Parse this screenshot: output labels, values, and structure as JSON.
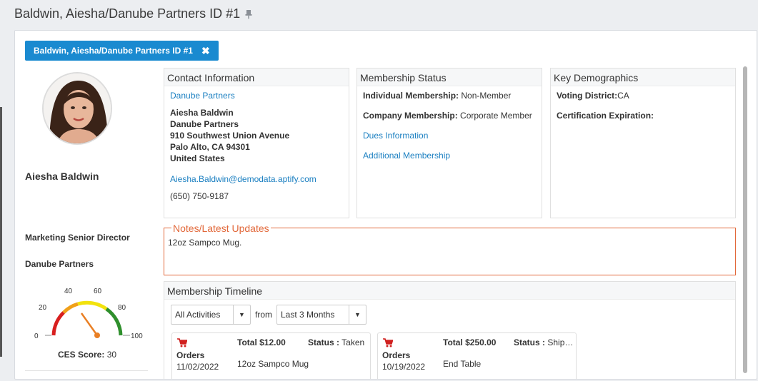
{
  "window": {
    "title": "Baldwin, Aiesha/Danube Partners ID #1"
  },
  "tab": {
    "label": "Baldwin, Aiesha/Danube Partners ID #1"
  },
  "profile": {
    "name": "Aiesha Baldwin",
    "job_title": "Marketing Senior Director",
    "company": "Danube Partners"
  },
  "ces": {
    "label": "CES Score:",
    "value": 30,
    "scale_labels": [
      "0",
      "20",
      "40",
      "60",
      "80",
      "100"
    ]
  },
  "contact": {
    "title": "Contact Information",
    "company_link": "Danube Partners",
    "name": "Aiesha Baldwin",
    "company": "Danube Partners",
    "street": "910 Southwest Union Avenue",
    "city": "Palo Alto, CA 94301",
    "country": "United States",
    "email": "Aiesha.Baldwin@demodata.aptify.com",
    "phone": "(650) 750-9187"
  },
  "membership": {
    "title": "Membership Status",
    "individual_label": "Individual Membership:",
    "individual_value": "Non-Member",
    "company_label": "Company Membership:",
    "company_value": "Corporate Member",
    "dues_link": "Dues Information",
    "additional_link": "Additional Membership"
  },
  "demographics": {
    "title": "Key Demographics",
    "voting_label": "Voting District:",
    "voting_value": "CA",
    "cert_label": "Certification Expiration:"
  },
  "notes": {
    "title": "Notes/Latest Updates",
    "text": "12oz Sampco Mug."
  },
  "timeline": {
    "title": "Membership Timeline",
    "activity_filter": "All Activities",
    "from_label": "from",
    "range_filter": "Last 3 Months",
    "entries": [
      {
        "type": "Orders",
        "date": "11/02/2022",
        "total": "Total $12.00",
        "status_label": "Status :",
        "status_value": "Taken",
        "description": "12oz Sampco Mug"
      },
      {
        "type": "Orders",
        "date": "10/19/2022",
        "total": "Total $250.00",
        "status_label": "Status :",
        "status_value": "Shipped",
        "description": "End Table"
      }
    ]
  },
  "colors": {
    "accent": "#1a8ad0",
    "link": "#1a7fc1",
    "notes_border": "#e2683a"
  }
}
